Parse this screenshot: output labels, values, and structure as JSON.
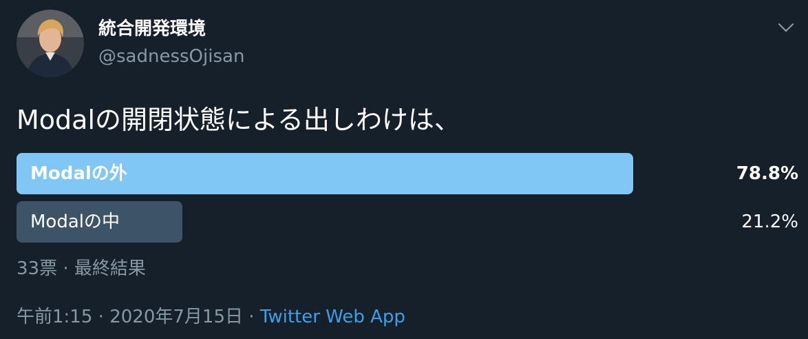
{
  "tweet": {
    "author": {
      "display_name": "統合開発環境",
      "handle": "@sadnessOjisan"
    },
    "text": "Modalの開閉状態による出しわけは、",
    "poll": {
      "options": [
        {
          "label": "Modalの外",
          "percent_text": "78.8%",
          "percent": 78.8,
          "leading": true
        },
        {
          "label": "Modalの中",
          "percent_text": "21.2%",
          "percent": 21.2,
          "leading": false
        }
      ],
      "votes": "33票",
      "separator": " · ",
      "status": "最終結果"
    },
    "timestamp": {
      "time": "午前1:15",
      "separator1": " · ",
      "date": "2020年7月15日",
      "separator2": " · ",
      "source": "Twitter Web App"
    }
  },
  "icons": {
    "menu_caret": "chevron-down-icon",
    "avatar": "avatar"
  },
  "colors": {
    "background": "#15202b",
    "leading_bar": "#80c7f5",
    "other_bar": "#3d5466",
    "muted_text": "#8899a6",
    "link": "#3f9fe6"
  }
}
